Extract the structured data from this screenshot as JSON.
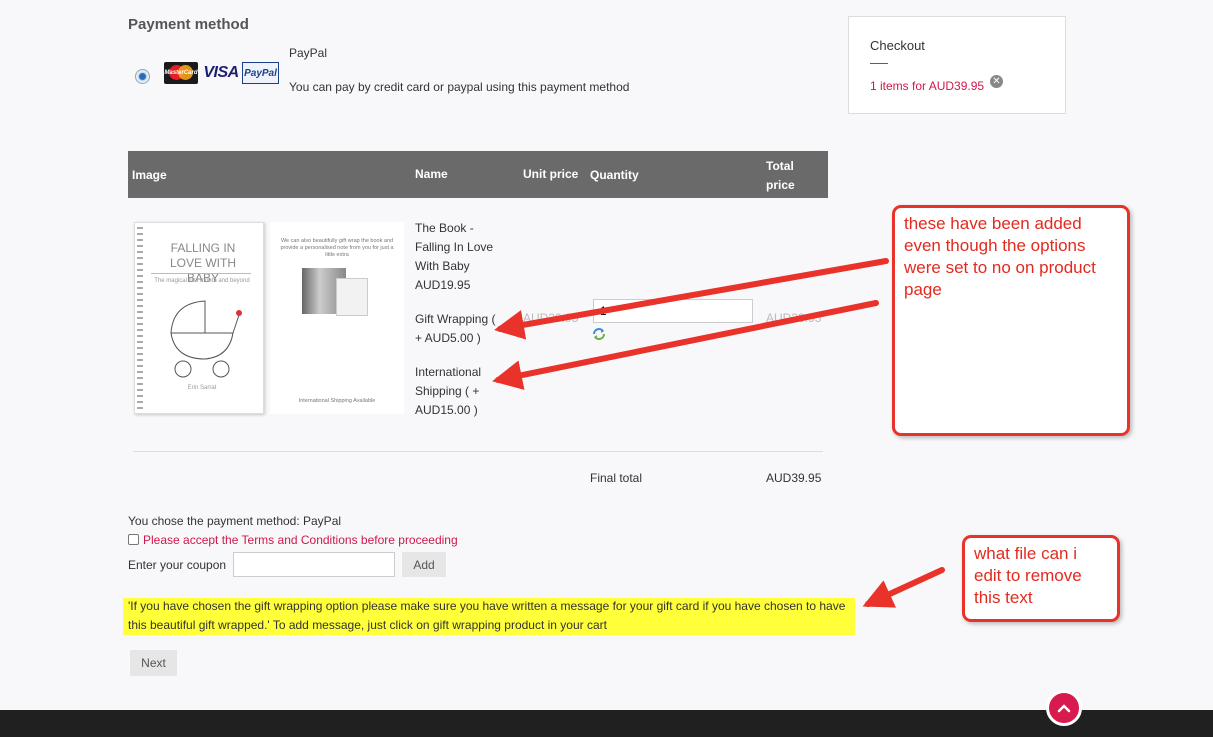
{
  "payment": {
    "title": "Payment method",
    "method_name": "PayPal",
    "method_desc": "You can pay by credit card or paypal using this payment method",
    "logos": {
      "mastercard": "MasterCard",
      "visa": "VISA",
      "paypal": "PayPal"
    }
  },
  "checkout": {
    "title": "Checkout",
    "summary": "1 items for AUD39.95"
  },
  "cart": {
    "headers": {
      "image": "Image",
      "name": "Name",
      "unit_price": "Unit price",
      "quantity": "Quantity",
      "total_price": "Total price"
    },
    "book_cover": {
      "title": "FALLING IN LOVE WITH BABY",
      "subtitle": "The magical first month and beyond",
      "author": "Erin Sarrat"
    },
    "wrap_image": {
      "text": "We can also beautifully gift wrap the book and provide a personalised note from you for just a little extra",
      "footer": "International Shipping Available"
    },
    "items": {
      "book": "The Book - Falling In Love With Baby AUD19.95",
      "wrap": "Gift Wrapping ( + AUD5.00 )",
      "shipping": "International Shipping ( + AUD15.00 )"
    },
    "unit_price": "AUD39.95",
    "quantity": "1",
    "total_price": "AUD39.95",
    "final_label": "Final total",
    "final_value": "AUD39.95"
  },
  "form": {
    "chosen_method": "You chose the payment method: PayPal",
    "terms": "Please accept the Terms and Conditions before proceeding",
    "coupon_label": "Enter your coupon",
    "coupon_value": "",
    "coupon_button": "Add",
    "gift_message": "'If you have chosen the gift wrapping option please make sure you have written a message for your gift card if you have chosen to have this beautiful gift wrapped.' To add message, just click on gift wrapping product in your cart",
    "next_button": "Next"
  },
  "annotations": {
    "callout_1": "these have been added even though the options were set to no on product page",
    "callout_2": "what file can i edit to remove this text"
  },
  "colors": {
    "accent": "#d0174a",
    "header_bg": "#6a6a6a",
    "highlight": "#ffff3a",
    "annotation": "#e8322a"
  }
}
